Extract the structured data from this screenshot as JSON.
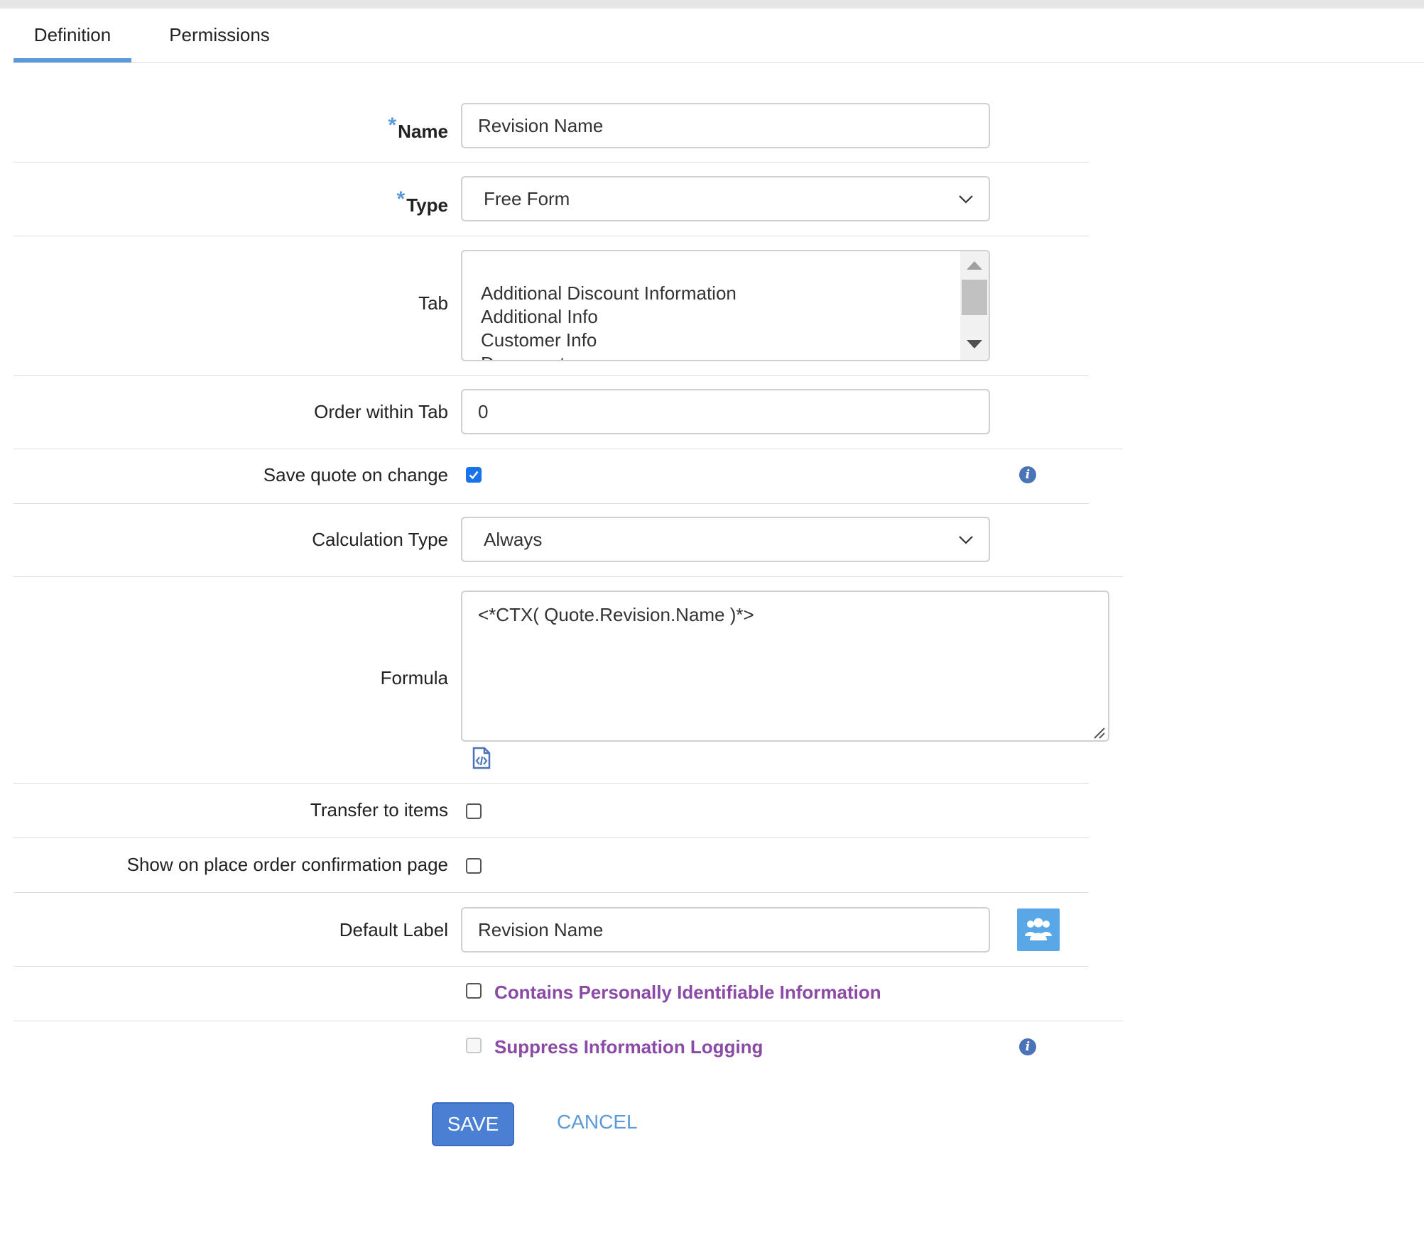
{
  "tabs": [
    {
      "label": "Definition",
      "active": true
    },
    {
      "label": "Permissions",
      "active": false
    }
  ],
  "form": {
    "required_marker": "*",
    "name": {
      "label": "Name",
      "value": "Revision Name"
    },
    "type": {
      "label": "Type",
      "value": "Free Form"
    },
    "tab": {
      "label": "Tab",
      "options": [
        "Additional Discount Information",
        "Additional Info",
        "Customer Info",
        "Documents"
      ]
    },
    "order_within_tab": {
      "label": "Order within Tab",
      "value": "0"
    },
    "save_quote_on_change": {
      "label": "Save quote on change",
      "checked": true
    },
    "calculation_type": {
      "label": "Calculation Type",
      "value": "Always"
    },
    "formula": {
      "label": "Formula",
      "value": "<*CTX( Quote.Revision.Name )*>"
    },
    "transfer_to_items": {
      "label": "Transfer to items",
      "checked": false
    },
    "show_on_place_order": {
      "label": "Show on place order confirmation page",
      "checked": false
    },
    "default_label": {
      "label": "Default Label",
      "value": "Revision Name"
    },
    "pii": {
      "label": "Contains Personally Identifiable Information",
      "checked": false
    },
    "suppress_logging": {
      "label": "Suppress Information Logging",
      "checked": false,
      "disabled": true
    }
  },
  "actions": {
    "save_label": "SAVE",
    "cancel_label": "CANCEL"
  },
  "icons": {
    "info": "info-icon",
    "formula_editor": "code-file-icon",
    "translations": "users-icon",
    "dropdown": "chevron-down-icon"
  },
  "colors": {
    "accent": "#5b9ad9",
    "save_button": "#4a7fd4",
    "pii_text": "#8a4aa6",
    "info_icon": "#4a73b8",
    "users_button": "#5aa7e8",
    "checkbox_checked": "#1a73e8"
  }
}
